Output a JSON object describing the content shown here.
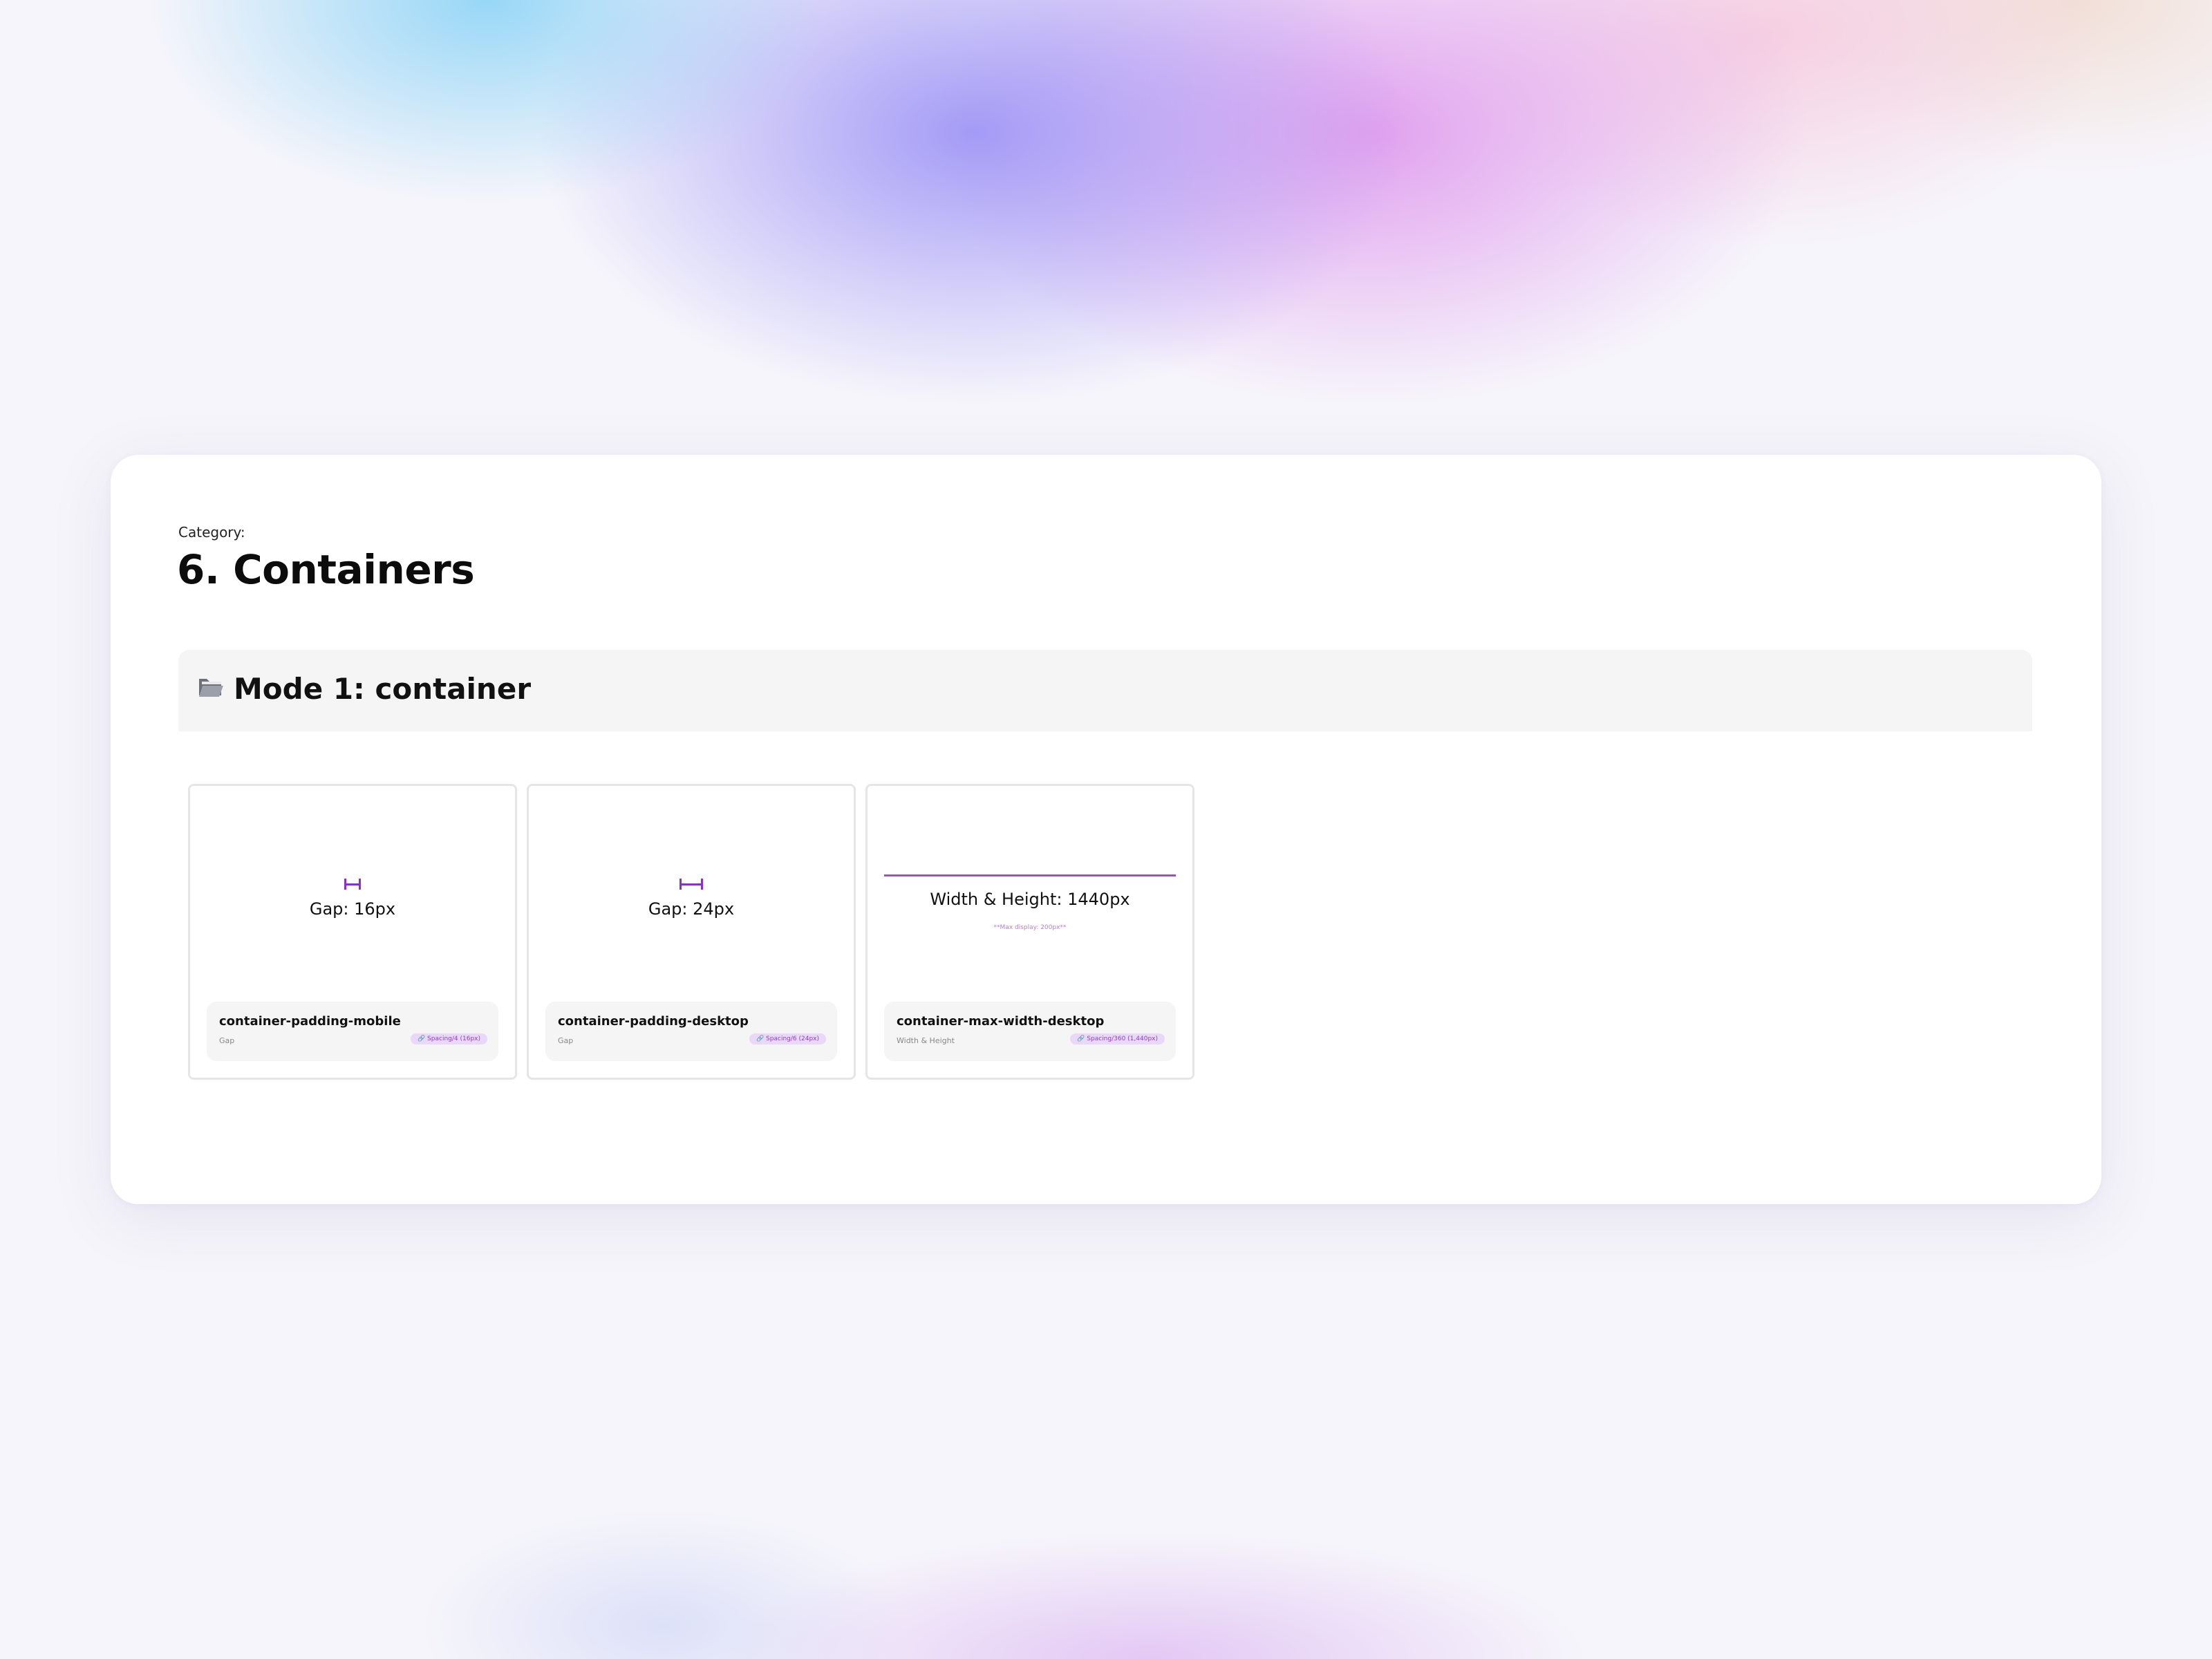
{
  "page": {
    "category_label": "Category:",
    "title": "6. Containers"
  },
  "mode": {
    "icon": "open-folder-icon",
    "title": "Mode 1: container"
  },
  "tokens": [
    {
      "visual": "gap",
      "visual_label": "Gap: 16px",
      "name": "container-padding-mobile",
      "kind": "Gap",
      "alias": "🔗 Spacing/4 (16px)"
    },
    {
      "visual": "gap",
      "visual_label": "Gap: 24px",
      "name": "container-padding-desktop",
      "kind": "Gap",
      "alias": "🔗 Spacing/6 (24px)"
    },
    {
      "visual": "width",
      "visual_label": "Width & Height: 1440px",
      "visual_note": "**Max display: 200px**",
      "name": "container-max-width-desktop",
      "kind": "Width & Height",
      "alias": "🔗 Spacing/360 (1,440px)"
    }
  ],
  "colors": {
    "accent": "#8b2fc9",
    "alias_bg": "#ead8f8",
    "info_bg": "#f5f5f5",
    "mode_bar_bg": "#f5f5f5"
  }
}
